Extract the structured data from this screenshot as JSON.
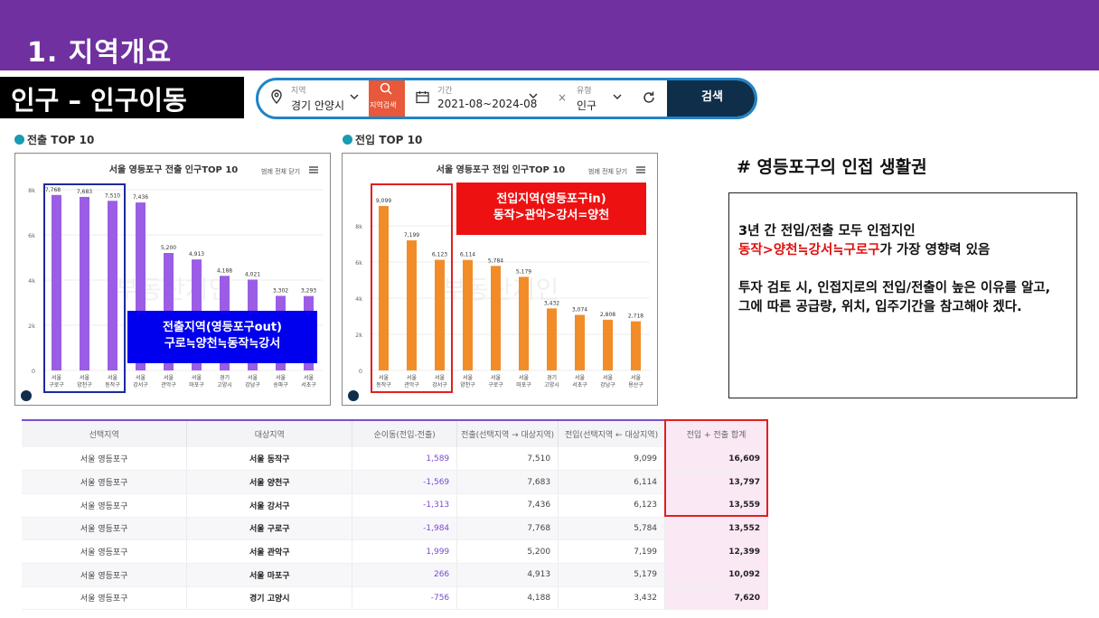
{
  "slide": {
    "banner_title": "1. 지역개요",
    "section_title": "인구 – 인구이동"
  },
  "filter": {
    "region_label": "지역",
    "region_value": "경기 안양시",
    "region_search_label": "지역검색",
    "period_label": "기간",
    "period_value": "2021-08~2024-08",
    "type_label": "유형",
    "type_value": "인구",
    "submit_label": "검색",
    "icons": {
      "location": "map-pin-icon",
      "search": "magnifier-icon",
      "calendar": "calendar-icon",
      "clear": "close-icon",
      "refresh": "refresh-icon",
      "dropdown": "chevron-down-icon"
    }
  },
  "captions": {
    "out_chart": "전출 TOP 10",
    "in_chart": "전입 TOP 10"
  },
  "chart_data": [
    {
      "type": "bar",
      "title": "서울 영등포구 전출 인구TOP 10",
      "legend_toggle": "범례 전체 닫기",
      "categories": [
        [
          "서울",
          "구로구"
        ],
        [
          "서울",
          "양천구"
        ],
        [
          "서울",
          "동작구"
        ],
        [
          "서울",
          "강서구"
        ],
        [
          "서울",
          "관악구"
        ],
        [
          "서울",
          "마포구"
        ],
        [
          "경기",
          "고양시"
        ],
        [
          "서울",
          "강남구"
        ],
        [
          "서울",
          "송파구"
        ],
        [
          "서울",
          "서초구"
        ]
      ],
      "values": [
        7768,
        7683,
        7510,
        7436,
        5200,
        4913,
        4188,
        4021,
        3302,
        3293
      ],
      "value_labels": [
        "7,768",
        "7,683",
        "7,510",
        "7,436",
        "5,200",
        "4,913",
        "4,188",
        "4,021",
        "3,302",
        "3,293"
      ],
      "yticks": [
        "0",
        "2k",
        "4k",
        "6k",
        "8k"
      ],
      "ylim": [
        0,
        8000
      ],
      "color": "#9b5de5",
      "watermark": "부동산지인",
      "annotation": {
        "lines": [
          "전출지역(영등포구out)",
          "구로≒양천≒동작≒강서"
        ],
        "bg": "#0000ee",
        "outline": "#1d2a9c"
      }
    },
    {
      "type": "bar",
      "title": "서울 영등포구 전입 인구TOP 10",
      "legend_toggle": "범례 전체 닫기",
      "categories": [
        [
          "서울",
          "동작구"
        ],
        [
          "서울",
          "관악구"
        ],
        [
          "서울",
          "강서구"
        ],
        [
          "서울",
          "양천구"
        ],
        [
          "서울",
          "구로구"
        ],
        [
          "서울",
          "마포구"
        ],
        [
          "경기",
          "고양시"
        ],
        [
          "서울",
          "서초구"
        ],
        [
          "서울",
          "강남구"
        ],
        [
          "서울",
          "용산구"
        ]
      ],
      "values": [
        9099,
        7199,
        6123,
        6114,
        5784,
        5179,
        3432,
        3074,
        2808,
        2718
      ],
      "value_labels": [
        "9,099",
        "7,199",
        "6,123",
        "6,114",
        "5,784",
        "5,179",
        "3,432",
        "3,074",
        "2,808",
        "2,718"
      ],
      "yticks": [
        "0",
        "2k",
        "4k",
        "6k",
        "8k"
      ],
      "ylim": [
        0,
        10000
      ],
      "color": "#f28c28",
      "watermark": "부동산지인",
      "annotation": {
        "lines": [
          "전입지역(영등포구in)",
          "동작>관악>강서=양천"
        ],
        "bg": "#ee1111",
        "outline": "#e02020"
      }
    }
  ],
  "note": {
    "title": "# 영등포구의 인접 생활권",
    "line1": "3년 간 전입/전출 모두 인접지인",
    "highlight": "동작>양천≒강서≒구로구",
    "line1_rest": "가 가장 영향력 있음",
    "line2": "투자 검토 시, 인접지로의 전입/전출이 높은 이유를 알고, 그에 따른 공급량, 위치, 입주기간을 참고해야 겠다."
  },
  "table": {
    "headers": [
      "선택지역",
      "대상지역",
      "순이동(전입-전출)",
      "전출(선택지역 → 대상지역)",
      "전입(선택지역 ← 대상지역)",
      "전입 + 전출 합계"
    ],
    "rows": [
      [
        "서울 영등포구",
        "서울 동작구",
        "1,589",
        "7,510",
        "9,099",
        "16,609"
      ],
      [
        "서울 영등포구",
        "서울 양천구",
        "-1,569",
        "7,683",
        "6,114",
        "13,797"
      ],
      [
        "서울 영등포구",
        "서울 강서구",
        "-1,313",
        "7,436",
        "6,123",
        "13,559"
      ],
      [
        "서울 영등포구",
        "서울 구로구",
        "-1,984",
        "7,768",
        "5,784",
        "13,552"
      ],
      [
        "서울 영등포구",
        "서울 관악구",
        "1,999",
        "5,200",
        "7,199",
        "12,399"
      ],
      [
        "서울 영등포구",
        "서울 마포구",
        "266",
        "4,913",
        "5,179",
        "10,092"
      ],
      [
        "서울 영등포구",
        "경기 고양시",
        "-756",
        "4,188",
        "3,432",
        "7,620"
      ]
    ]
  },
  "colors": {
    "banner": "#7030a0",
    "accent": "#1f84c6",
    "highlight_red": "#e01010"
  }
}
